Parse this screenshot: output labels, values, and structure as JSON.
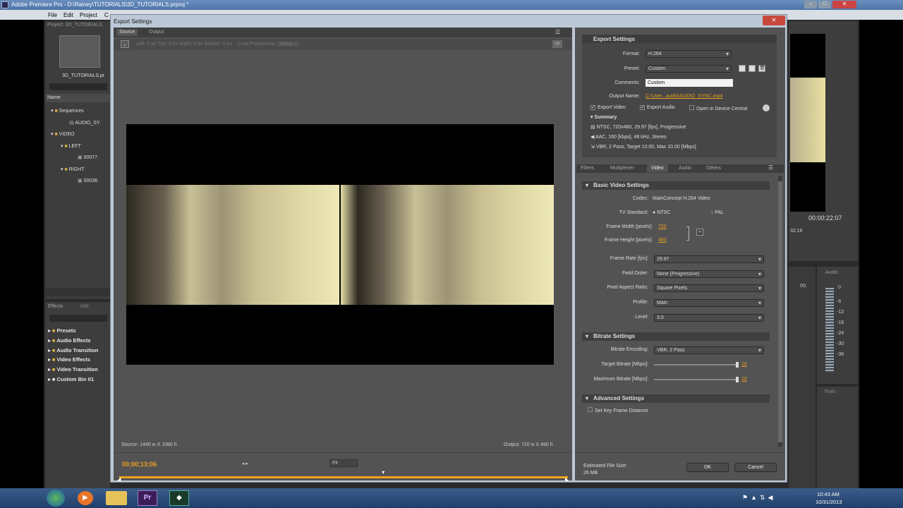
{
  "app": {
    "title": "Adobe Premiere Pro - D:\\Rainey\\TUTORIALS\\3D_TUTORIALS.prproj *",
    "menu": [
      "File",
      "Edit",
      "Project",
      "C"
    ]
  },
  "project": {
    "tab": "Project: 3D_TUTORIALS",
    "file": "3D_TUTORIALS.pr",
    "col_name": "Name",
    "tree": [
      {
        "label": "Sequences",
        "level": 1
      },
      {
        "label": "AUDIO_SY",
        "level": 2
      },
      {
        "label": "VIDEO",
        "level": 1
      },
      {
        "label": "LEFT",
        "level": 2
      },
      {
        "label": "00077.",
        "level": 3
      },
      {
        "label": "RIGHT",
        "level": 2
      },
      {
        "label": "00036.",
        "level": 3
      }
    ]
  },
  "effects": {
    "tabs": [
      "Effects",
      "Info"
    ],
    "items": [
      "Presets",
      "Audio Effects",
      "Audio Transition",
      "Video Effects",
      "Video Transition",
      "Custom Bin 01"
    ]
  },
  "right_monitor": {
    "timecode": "00:00:22:07",
    "ruler": "32;16",
    "audio_label": "Audio",
    "audio_zero": "0",
    "ruler_value": "00;",
    "db_scale": [
      "-6",
      "-12",
      "-18",
      "-24",
      "-30",
      "-36"
    ],
    "tools_label": "Tools"
  },
  "dialog": {
    "title": "Export Settings",
    "close": "✕",
    "tabs": [
      "Source",
      "Output"
    ],
    "crop": {
      "left_label": "Left:",
      "left_value": "0",
      "left_unit": "px",
      "top_label": "Top:",
      "top_value": "0",
      "top_unit": "px",
      "right_label": "Right:",
      "right_value": "0",
      "right_unit": "px",
      "bottom_label": "Bottom:",
      "bottom_value": "0",
      "bottom_unit": "px",
      "prop_label": "Crop Proportions:",
      "prop_value": "None"
    },
    "source_info": "Source: 1440 w X 1080 h",
    "output_info": "Output: 720 w X 480 h",
    "timecode": "00;00;13;06",
    "fit": "Fit",
    "playhead_fraction": 0.59
  },
  "export": {
    "header": "Export Settings",
    "format_label": "Format:",
    "format": "H.264",
    "preset_label": "Preset:",
    "preset": "Custom",
    "comments_label": "Comments:",
    "comments": "Custom",
    "output_label": "Output Name:",
    "output": "C:\\User...audio\\AUDIO_SYNC.mp4",
    "export_video": "Export Video",
    "export_audio": "Export Audio",
    "device_central": "Open in Device Central",
    "summary_label": "Summary",
    "summary": [
      "NTSC, 720x480, 29.97 [fps], Progressive",
      "AAC, 160 [kbps], 48 kHz, Stereo",
      "VBR, 2 Pass, Target 10.00, Max 10.00 [Mbps]"
    ],
    "tabs": [
      "Filters",
      "Multiplexer",
      "Video",
      "Audio",
      "Others"
    ],
    "active_tab": "Video",
    "basic_header": "Basic Video Settings",
    "codec_label": "Codec:",
    "codec": "MainConcept H.264 Video",
    "tv_label": "TV Standard:",
    "ntsc": "NTSC",
    "pal": "PAL",
    "fw_label": "Frame Width [pixels]:",
    "fw": "720",
    "fh_label": "Frame Height [pixels]:",
    "fh": "480",
    "fr_label": "Frame Rate [fps]:",
    "fr": "29.97",
    "fo_label": "Field Order:",
    "fo": "None (Progressive)",
    "par_label": "Pixel Aspect Ratio:",
    "par": "Square Pixels",
    "profile_label": "Profile:",
    "profile": "Main",
    "level_label": "Level:",
    "level": "3.0",
    "bitrate_header": "Bitrate Settings",
    "enc_label": "Bitrate Encoding:",
    "enc": "VBR, 2 Pass",
    "tb_label": "Target Bitrate [Mbps]:",
    "tb": "10",
    "mb_label": "Maximum Bitrate [Mbps]:",
    "mb": "10",
    "adv_header": "Advanced Settings",
    "keyframe": "Set Key Frame Distance",
    "size_label": "Estimated File Size:",
    "size": "26 MB",
    "ok": "OK",
    "cancel": "Cancel"
  },
  "taskbar": {
    "time": "10:43 AM",
    "date": "10/31/2013",
    "pr_label": "Pr"
  },
  "colors": {
    "accent": "#f0a020",
    "orange_text": "#e8a020",
    "dialog_bg": "#535353",
    "panel_bg": "#3a3a3a"
  }
}
